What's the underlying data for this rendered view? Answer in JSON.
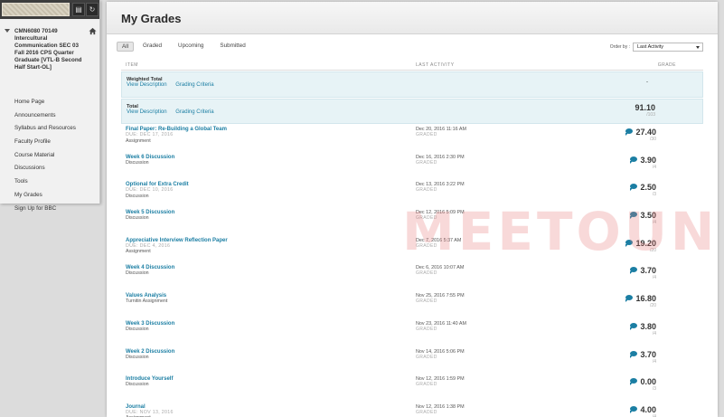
{
  "sidebar": {
    "course_title": "CMN6080 70149 Intercultural Communication SEC 03 Fall 2016 CPS Quarter Graduate [VTL-B Second Half Start-OL]",
    "items": [
      {
        "label": "Home Page"
      },
      {
        "label": "Announcements"
      },
      {
        "label": "Syllabus and Resources"
      },
      {
        "label": "Faculty Profile"
      },
      {
        "label": "Course Material"
      },
      {
        "label": "Discussions"
      },
      {
        "label": "Tools"
      },
      {
        "label": "My Grades"
      },
      {
        "label": "Sign Up for BBC"
      }
    ]
  },
  "page": {
    "title": "My Grades"
  },
  "filters": {
    "all": "All",
    "graded": "Graded",
    "upcoming": "Upcoming",
    "submitted": "Submitted"
  },
  "order": {
    "label": "Order by :",
    "value": "Last Activity"
  },
  "columns": {
    "item": "ITEM",
    "last_activity": "LAST ACTIVITY",
    "grade": "GRADE"
  },
  "calculated": [
    {
      "title": "Weighted Total",
      "link1": "View Description",
      "link2": "Grading Criteria",
      "grade": "-",
      "points": ""
    },
    {
      "title": "Total",
      "link1": "View Description",
      "link2": "Grading Criteria",
      "grade": "91.10",
      "points": "/103"
    }
  ],
  "grades": [
    {
      "title": "Final Paper: Re-Building a Global Team",
      "due": "DUE: DEC 17, 2016",
      "type": "Assignment",
      "date": "Dec 20, 2016 11:16 AM",
      "status": "GRADED",
      "score": "27.40",
      "points": "/30"
    },
    {
      "title": "Week 6 Discussion",
      "due": "",
      "type": "Discussion",
      "date": "Dec 16, 2016 2:30 PM",
      "status": "GRADED",
      "score": "3.90",
      "points": "/4"
    },
    {
      "title": "Optional for Extra Credit",
      "due": "DUE: DEC 10, 2016",
      "type": "Discussion",
      "date": "Dec 13, 2016 3:22 PM",
      "status": "GRADED",
      "score": "2.50",
      "points": "/3"
    },
    {
      "title": "Week 5 Discussion",
      "due": "",
      "type": "Discussion",
      "date": "Dec 12, 2016 5:09 PM",
      "status": "GRADED",
      "score": "3.50",
      "points": "/4"
    },
    {
      "title": "Appreciative Interview Reflection Paper",
      "due": "DUE: DEC 4, 2016",
      "type": "Assignment",
      "date": "Dec 7, 2016 5:37 AM",
      "status": "GRADED",
      "score": "19.20",
      "points": "/20"
    },
    {
      "title": "Week 4 Discussion",
      "due": "",
      "type": "Discussion",
      "date": "Dec 6, 2016 10:07 AM",
      "status": "GRADED",
      "score": "3.70",
      "points": "/4"
    },
    {
      "title": "Values Analysis",
      "due": "",
      "type": "Turnitin Assignment",
      "date": "Nov 25, 2016 7:55 PM",
      "status": "GRADED",
      "score": "16.80",
      "points": "/20"
    },
    {
      "title": "Week 3 Discussion",
      "due": "",
      "type": "Discussion",
      "date": "Nov 23, 2016 11:40 AM",
      "status": "GRADED",
      "score": "3.80",
      "points": "/4"
    },
    {
      "title": "Week 2 Discussion",
      "due": "",
      "type": "Discussion",
      "date": "Nov 14, 2016 5:06 PM",
      "status": "GRADED",
      "score": "3.70",
      "points": "/4"
    },
    {
      "title": "Introduce Yourself",
      "due": "",
      "type": "Discussion",
      "date": "Nov 12, 2016 1:59 PM",
      "status": "GRADED",
      "score": "0.00",
      "points": "/3"
    },
    {
      "title": "Journal",
      "due": "DUE: NOV 13, 2016",
      "type": "Assignment",
      "date": "Nov 12, 2016 1:38 PM",
      "status": "GRADED",
      "score": "4.00",
      "points": "/4"
    }
  ],
  "watermark": "MEETOUN"
}
